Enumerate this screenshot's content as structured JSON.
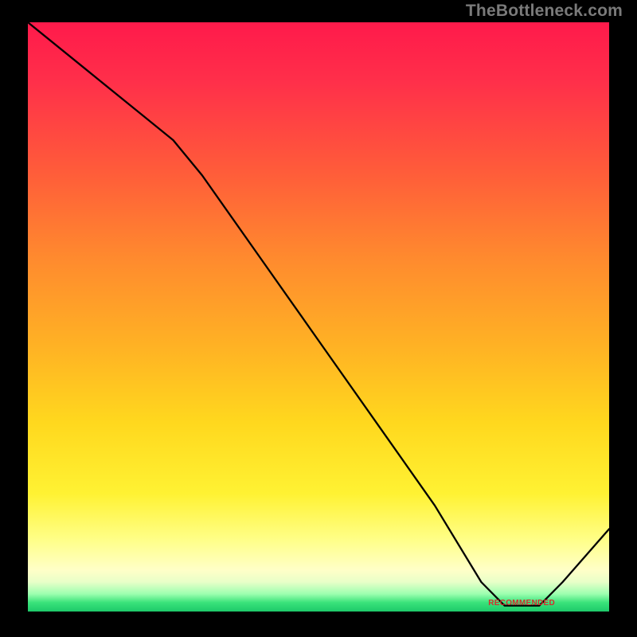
{
  "watermark": "TheBottleneck.com",
  "annotation_label": "RECOMMENDED",
  "chart_data": {
    "type": "line",
    "title": "",
    "xlabel": "",
    "ylabel": "",
    "xlim": [
      0,
      100
    ],
    "ylim": [
      0,
      100
    ],
    "grid": false,
    "legend": false,
    "comment": "V-shaped bottleneck curve; y≈0 (green) is the recommended zone, higher y = worse (red). Values are read off the plotted black line; x is a normalized parameter.",
    "x": [
      0,
      10,
      20,
      25,
      30,
      40,
      50,
      60,
      70,
      78,
      82,
      88,
      92,
      100
    ],
    "values": [
      100,
      92,
      84,
      80,
      74,
      60,
      46,
      32,
      18,
      5,
      1,
      1,
      5,
      14
    ],
    "recommended_range_x": [
      80,
      90
    ],
    "annotation": {
      "text": "RECOMMENDED",
      "x": 84,
      "y": 1
    }
  }
}
